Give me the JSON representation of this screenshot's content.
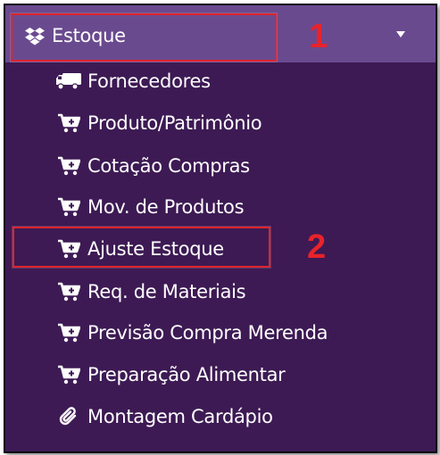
{
  "menu": {
    "header": {
      "label": "Estoque",
      "icon": "dropbox-icon"
    },
    "items": [
      {
        "label": "Fornecedores",
        "icon": "truck-icon"
      },
      {
        "label": "Produto/Patrimônio",
        "icon": "cart-plus-icon"
      },
      {
        "label": "Cotação Compras",
        "icon": "cart-plus-icon"
      },
      {
        "label": "Mov. de Produtos",
        "icon": "cart-plus-icon"
      },
      {
        "label": "Ajuste Estoque",
        "icon": "cart-plus-icon"
      },
      {
        "label": "Req. de Materiais",
        "icon": "cart-plus-icon"
      },
      {
        "label": "Previsão Compra Merenda",
        "icon": "cart-plus-icon"
      },
      {
        "label": "Preparação Alimentar",
        "icon": "cart-plus-icon"
      },
      {
        "label": "Montagem Cardápio",
        "icon": "paperclip-icon"
      }
    ]
  },
  "annotations": {
    "step1": "1",
    "step2": "2"
  },
  "colors": {
    "menu_background": "#3d1a54",
    "header_background": "#6a4a8f",
    "text": "#ffffff",
    "annotation": "#e0242c"
  }
}
